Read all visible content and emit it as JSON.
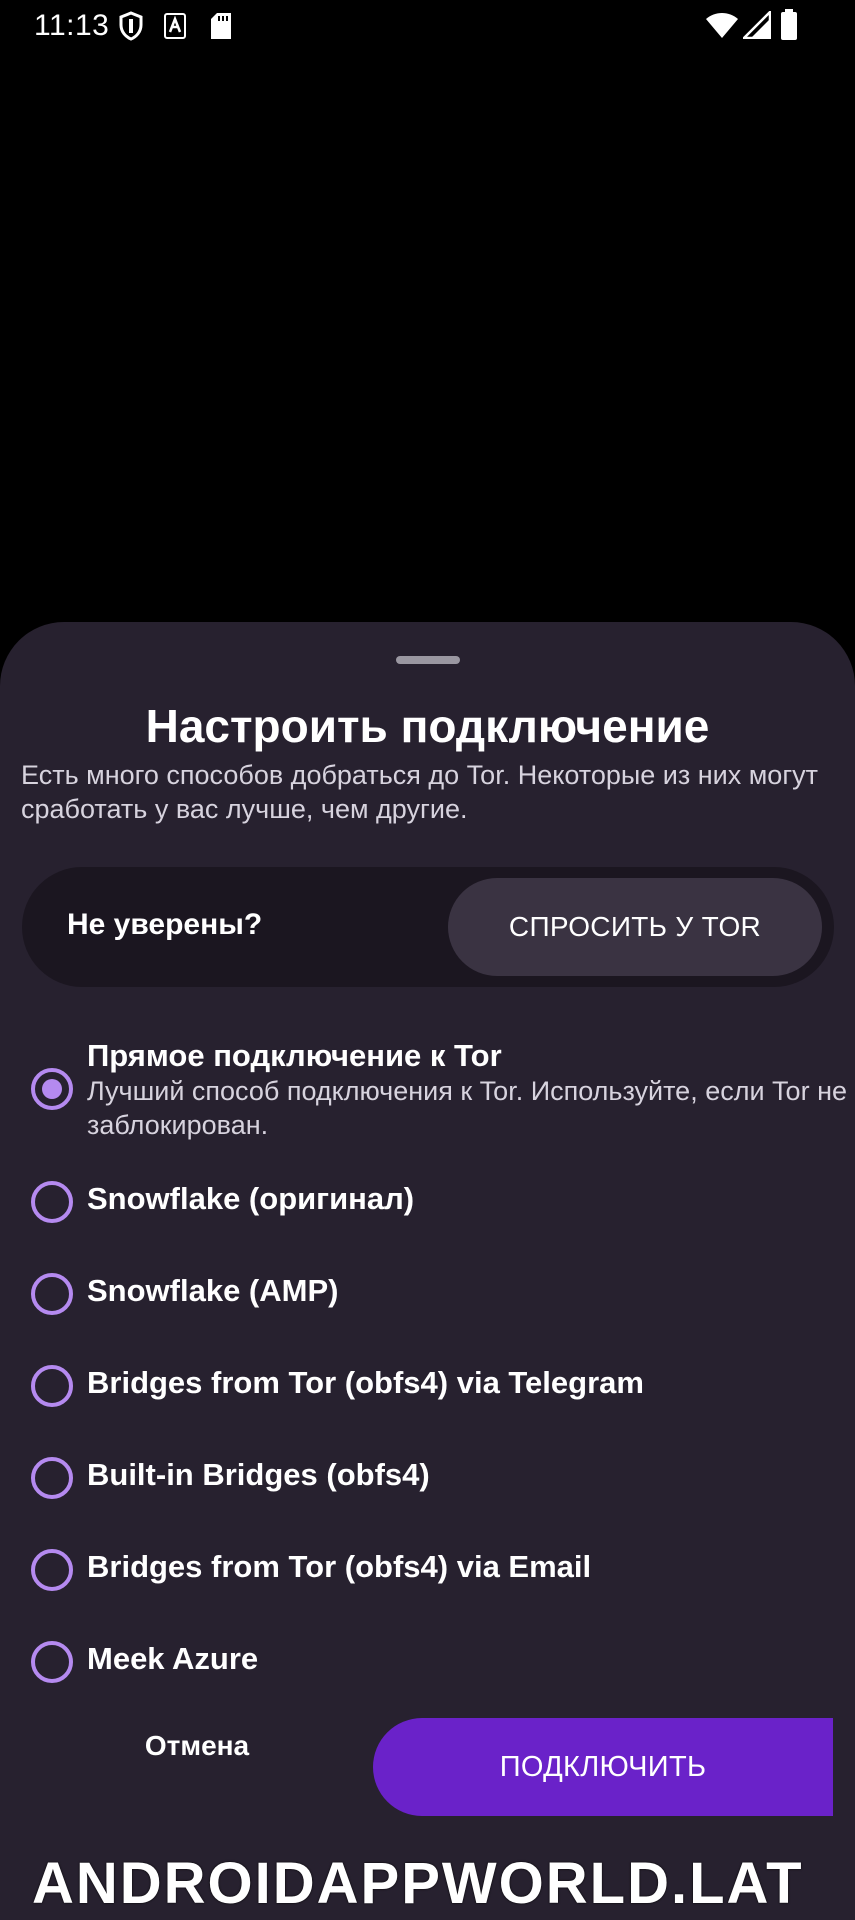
{
  "status_bar": {
    "time": "11:13",
    "icons": [
      "shield-icon",
      "a-notification-icon",
      "sd-card-icon",
      "wifi-icon",
      "signal-icon",
      "battery-icon"
    ]
  },
  "sheet": {
    "title": "Настроить подключение",
    "description": "Есть много способов добраться до Tor. Некоторые из них могут сработать у вас лучше, чем другие.",
    "ask_card": {
      "label": "Не уверены?",
      "button_label": "СПРОСИТЬ У TOR"
    },
    "options": [
      {
        "title": "Прямое подключение к Tor",
        "description": "Лучший способ подключения к Tor. Используйте, если Tor не заблокирован.",
        "selected": true
      },
      {
        "title": "Snowflake (оригинал)",
        "selected": false
      },
      {
        "title": "Snowflake (AMP)",
        "selected": false
      },
      {
        "title": "Bridges from Tor (obfs4) via Telegram",
        "selected": false
      },
      {
        "title": "Built-in Bridges (obfs4)",
        "selected": false
      },
      {
        "title": "Bridges from Tor (obfs4) via Email",
        "selected": false
      },
      {
        "title": "Meek Azure",
        "selected": false
      }
    ],
    "cancel_label": "Отмена",
    "connect_label": "ПОДКЛЮЧИТЬ"
  },
  "watermark": "ANDROIDAPPWORLD.LAT",
  "colors": {
    "sheet_background": "#27212f",
    "accent_purple": "#6a22c9",
    "radio_purple": "#b58af0",
    "ask_card_background": "#1b1620",
    "ask_button_background": "#3a3342"
  }
}
